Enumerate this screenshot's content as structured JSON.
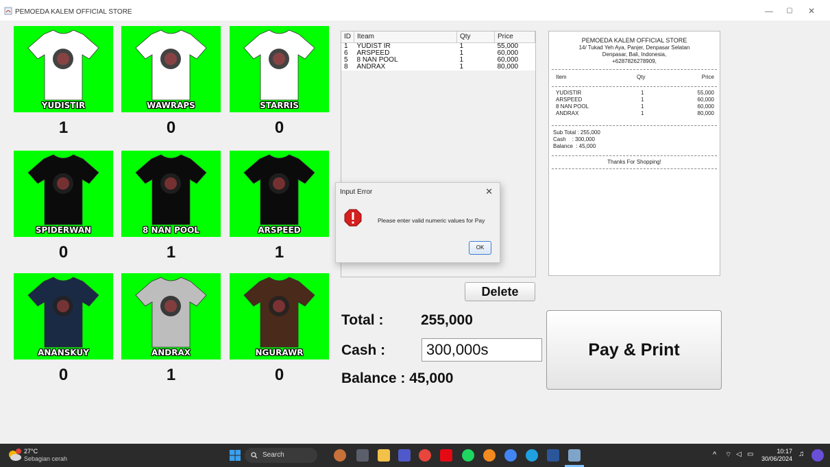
{
  "window": {
    "title": "PEMOEDA KALEM OFFICIAL STORE",
    "min_glyph": "—",
    "max_glyph": "▢",
    "close_glyph": "✕"
  },
  "products": [
    {
      "name": "YUDISTIR",
      "qty": "1",
      "icon": "white-shirt-portrait"
    },
    {
      "name": "WAWRAPS",
      "qty": "0",
      "icon": "white-shirt-skulls"
    },
    {
      "name": "STARRIS",
      "qty": "0",
      "icon": "white-shirt-portrait"
    },
    {
      "name": "SPIDERWAN",
      "qty": "0",
      "icon": "black-shirt-web"
    },
    {
      "name": "8 NAN POOL",
      "qty": "1",
      "icon": "black-shirt-8ball"
    },
    {
      "name": "ARSPEED",
      "qty": "1",
      "icon": "black-shirt-portrait"
    },
    {
      "name": "ANANSKUY",
      "qty": "0",
      "icon": "navy-shirt-sun"
    },
    {
      "name": "ANDRAX",
      "qty": "1",
      "icon": "grey-shirt-portrait"
    },
    {
      "name": "NGURAWR",
      "qty": "0",
      "icon": "brown-shirt-star"
    }
  ],
  "table": {
    "headers": [
      "ID",
      "Iteam",
      "Qty",
      "Price"
    ],
    "rows": [
      [
        "1",
        "YUDIST IR",
        "1",
        "55,000"
      ],
      [
        "6",
        "ARSPEED",
        "1",
        "60,000"
      ],
      [
        "5",
        "8 NAN POOL",
        "1",
        "60,000"
      ],
      [
        "8",
        "ANDRAX",
        "1",
        "80,000"
      ]
    ]
  },
  "receipt": {
    "store": "PEMOEDA KALEM OFFICIAL STORE",
    "address1": "14/ Tukad Yeh Aya, Panjer, Denpasar Selatan",
    "address2": "Denpasar, Bali, Indonesia,",
    "phone": "+6287826278909,",
    "col_item": "Item",
    "col_qty": "Qty",
    "col_price": "Price",
    "items": [
      [
        "YUDISTIR",
        "1",
        "55,000"
      ],
      [
        "ARSPEED",
        "1",
        "60,000"
      ],
      [
        "8 NAN POOL",
        "1",
        "60,000"
      ],
      [
        "ANDRAX",
        "1",
        "80,000"
      ]
    ],
    "subtotal": "Sub Total : 255,000",
    "cash": "Cash    : 300,000",
    "balance": "Balance  : 45,000",
    "thanks": "Thanks For Shopping!"
  },
  "dialog": {
    "title": "Input Error",
    "close": "✕",
    "message": "Please enter valid numeric values for Pay",
    "ok": "OK"
  },
  "actions": {
    "delete": "Delete",
    "pay": "Pay & Print"
  },
  "totals": {
    "total_label": "Total :",
    "total_value": "255,000",
    "cash_label": "Cash :",
    "cash_value": "300,000s",
    "balance_text": "Balance : 45,000"
  },
  "taskbar": {
    "temp": "27°C",
    "weather": "Sebagian cerah",
    "search": "Search",
    "time": "10:17",
    "date": "30/06/2024"
  }
}
